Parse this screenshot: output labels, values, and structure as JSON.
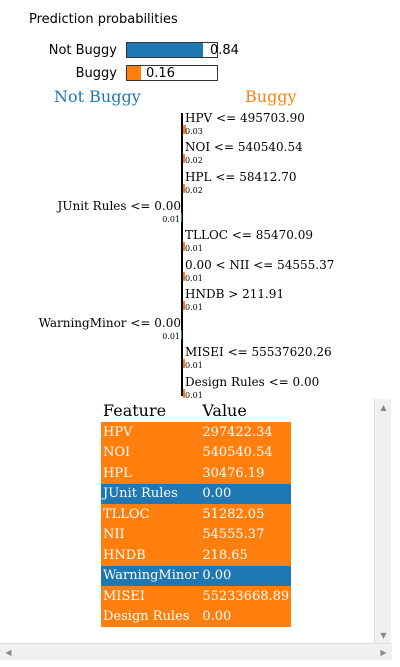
{
  "title": "Prediction probabilities",
  "colors": {
    "not_buggy": "#1f77b4",
    "buggy": "#ff7f0e"
  },
  "probabilities": [
    {
      "label": "Not Buggy",
      "value": 0.84,
      "display": "0.84",
      "color": "#1f77b4"
    },
    {
      "label": "Buggy",
      "value": 0.16,
      "display": "0.16",
      "color": "#ff7f0e"
    }
  ],
  "class_left": "Not Buggy",
  "class_right": "Buggy",
  "chart_data": {
    "type": "bar",
    "orientation": "horizontal",
    "categories": [
      "HPV <= 495703.90",
      "NOI <= 540540.54",
      "HPL <= 58412.70",
      "JUnit Rules <= 0.00",
      "TLLOC <= 85470.09",
      "0.00 < NII <= 54555.37",
      "HNDB > 211.91",
      "WarningMinor <= 0.00",
      "MISEI <= 55537620.26",
      "Design Rules <= 0.00"
    ],
    "values": [
      0.03,
      0.02,
      0.02,
      -0.01,
      0.01,
      0.01,
      0.01,
      -0.01,
      0.01,
      0.01
    ],
    "labels": [
      "0.03",
      "0.02",
      "0.02",
      "0.01",
      "0.01",
      "0.01",
      "0.01",
      "0.01",
      "0.01",
      "0.01"
    ],
    "series": [
      {
        "name": "Not Buggy",
        "color": "#1f77b4"
      },
      {
        "name": "Buggy",
        "color": "#ff7f0e"
      }
    ]
  },
  "table": {
    "headers": [
      "Feature",
      "Value"
    ],
    "rows": [
      {
        "feature": "HPV",
        "value": "297422.34",
        "side": "buggy"
      },
      {
        "feature": "NOI",
        "value": "540540.54",
        "side": "buggy"
      },
      {
        "feature": "HPL",
        "value": "30476.19",
        "side": "buggy"
      },
      {
        "feature": "JUnit Rules",
        "value": "0.00",
        "side": "not_buggy"
      },
      {
        "feature": "TLLOC",
        "value": "51282.05",
        "side": "buggy"
      },
      {
        "feature": "NII",
        "value": "54555.37",
        "side": "buggy"
      },
      {
        "feature": "HNDB",
        "value": "218.65",
        "side": "buggy"
      },
      {
        "feature": "WarningMinor",
        "value": "0.00",
        "side": "not_buggy"
      },
      {
        "feature": "MISEI",
        "value": "55233668.89",
        "side": "buggy"
      },
      {
        "feature": "Design Rules",
        "value": "0.00",
        "side": "buggy"
      }
    ]
  }
}
